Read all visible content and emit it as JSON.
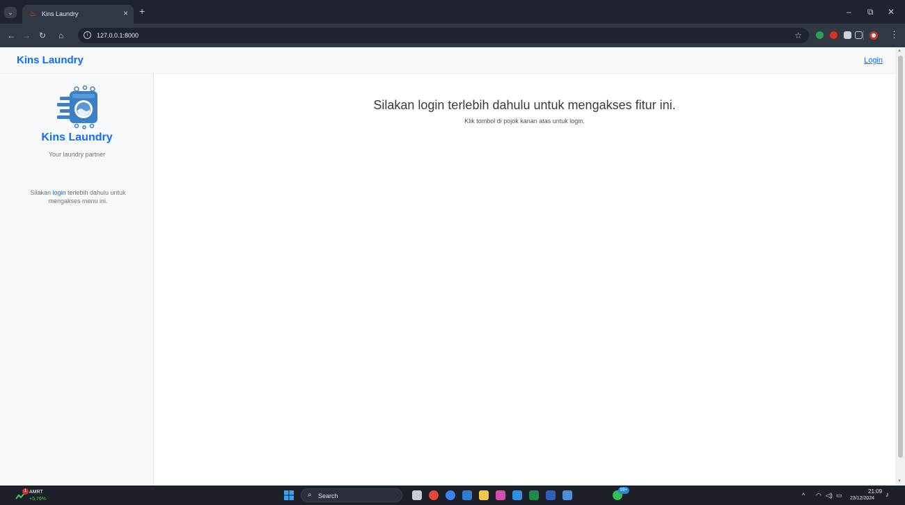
{
  "browser": {
    "tab_title": "Kins Laundry",
    "tab_close": "×",
    "new_tab": "+",
    "url": "127.0.0.1:8000",
    "window_minimize": "–",
    "window_maximize": "⧉",
    "window_close": "✕",
    "back_icon": "←",
    "forward_icon": "→",
    "reload_icon": "↻",
    "home_icon": "⌂",
    "menu_icon": "⋮",
    "bookmark_icon": "☆"
  },
  "navbar": {
    "brand": "Kins Laundry",
    "login": "Login"
  },
  "sidebar": {
    "title": "Kins Laundry",
    "subtitle": "Your laundry partner",
    "message_prefix": "Silakan ",
    "message_link": "login",
    "message_suffix": " terlebih dahulu untuk mengakses menu ini."
  },
  "main": {
    "heading": "Silakan login terlebih dahulu untuk mengakses fitur ini.",
    "subtext": "Klik tombol di pojok kanan atas untuk login."
  },
  "taskbar": {
    "stock_name": "AMRT",
    "stock_change": "+5.76%",
    "stock_badge": "1",
    "search_placeholder": "Search",
    "whatsapp_badge": "99+",
    "time": "21:09",
    "date": "23/12/2024"
  },
  "colors": {
    "brand_blue": "#0d6efd",
    "chrome_dark": "#1f2331",
    "toolbar": "#323744",
    "taskbar": "#1d2029"
  }
}
